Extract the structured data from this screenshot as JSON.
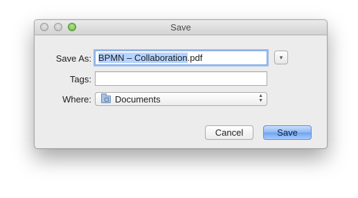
{
  "window": {
    "title": "Save"
  },
  "form": {
    "save_as_label": "Save As:",
    "save_as_value_selected": "BPMN – Collaboration",
    "save_as_value_ext": ".pdf",
    "tags_label": "Tags:",
    "tags_value": "",
    "where_label": "Where:",
    "where_value": "Documents"
  },
  "buttons": {
    "cancel": "Cancel",
    "save": "Save",
    "expand_glyph": "▾"
  },
  "icons": {
    "where": "folder-icon",
    "expand": "disclosure-triangle-icon",
    "popup": "up-down-arrows-icon"
  },
  "colors": {
    "selection": "#b5d3ff",
    "default_button": "#8db8f3",
    "focus_ring": "#7aa7e8",
    "zoom_button": "#5fb23a"
  }
}
